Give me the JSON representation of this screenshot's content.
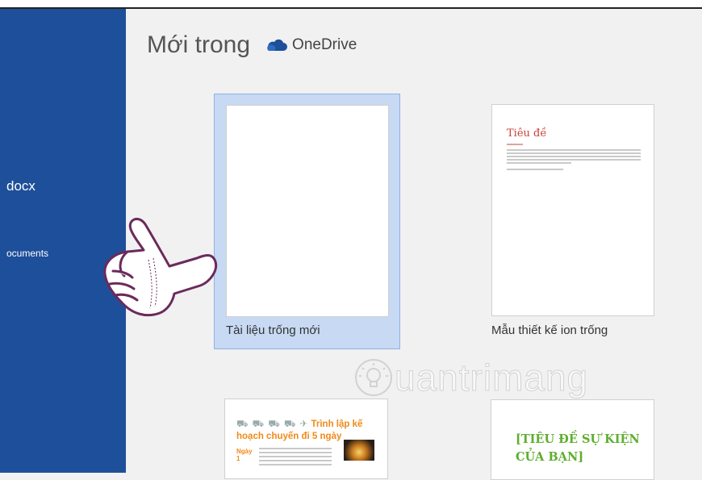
{
  "sidebar": {
    "file_name": "docx",
    "location": "ocuments"
  },
  "header": {
    "title": "Mới trong",
    "service": "OneDrive"
  },
  "templates": [
    {
      "label": "Tài liệu trống mới",
      "selected": true
    },
    {
      "label": "Mẫu thiết kế ion trống",
      "selected": false,
      "preview_title": "Tiêu đề"
    },
    {
      "label": "",
      "preview_title": "Trình lập kế hoạch chuyến đi 5 ngày",
      "preview_day": "Ngày\n1"
    },
    {
      "label": "",
      "preview_title": "[TIÊU ĐỀ SỰ KIỆN CỦA BẠN]"
    }
  ],
  "watermark": "uantrimang",
  "colors": {
    "sidebar": "#1e4f9a",
    "selected_tile": "#c7d9f3",
    "onedrive": "#1e4f9a",
    "heading_red": "#c8443a",
    "plan_orange": "#f08a18",
    "event_green": "#5fae2e"
  },
  "icons": [
    "onedrive-cloud-icon",
    "pointing-hand-icon",
    "watermark-bulb-icon"
  ]
}
